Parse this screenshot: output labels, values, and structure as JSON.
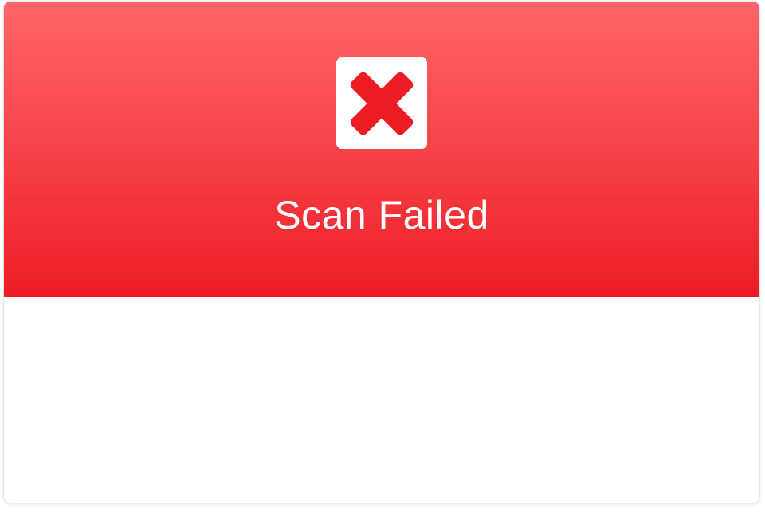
{
  "dialog": {
    "status_icon": "close-x-icon",
    "title": "Scan Failed",
    "body_text": ""
  },
  "colors": {
    "header_top": "#ff6468",
    "header_bottom": "#ed1c24",
    "icon_mark": "#ed1c24",
    "title_text": "#ffffff",
    "background": "#ffffff"
  }
}
